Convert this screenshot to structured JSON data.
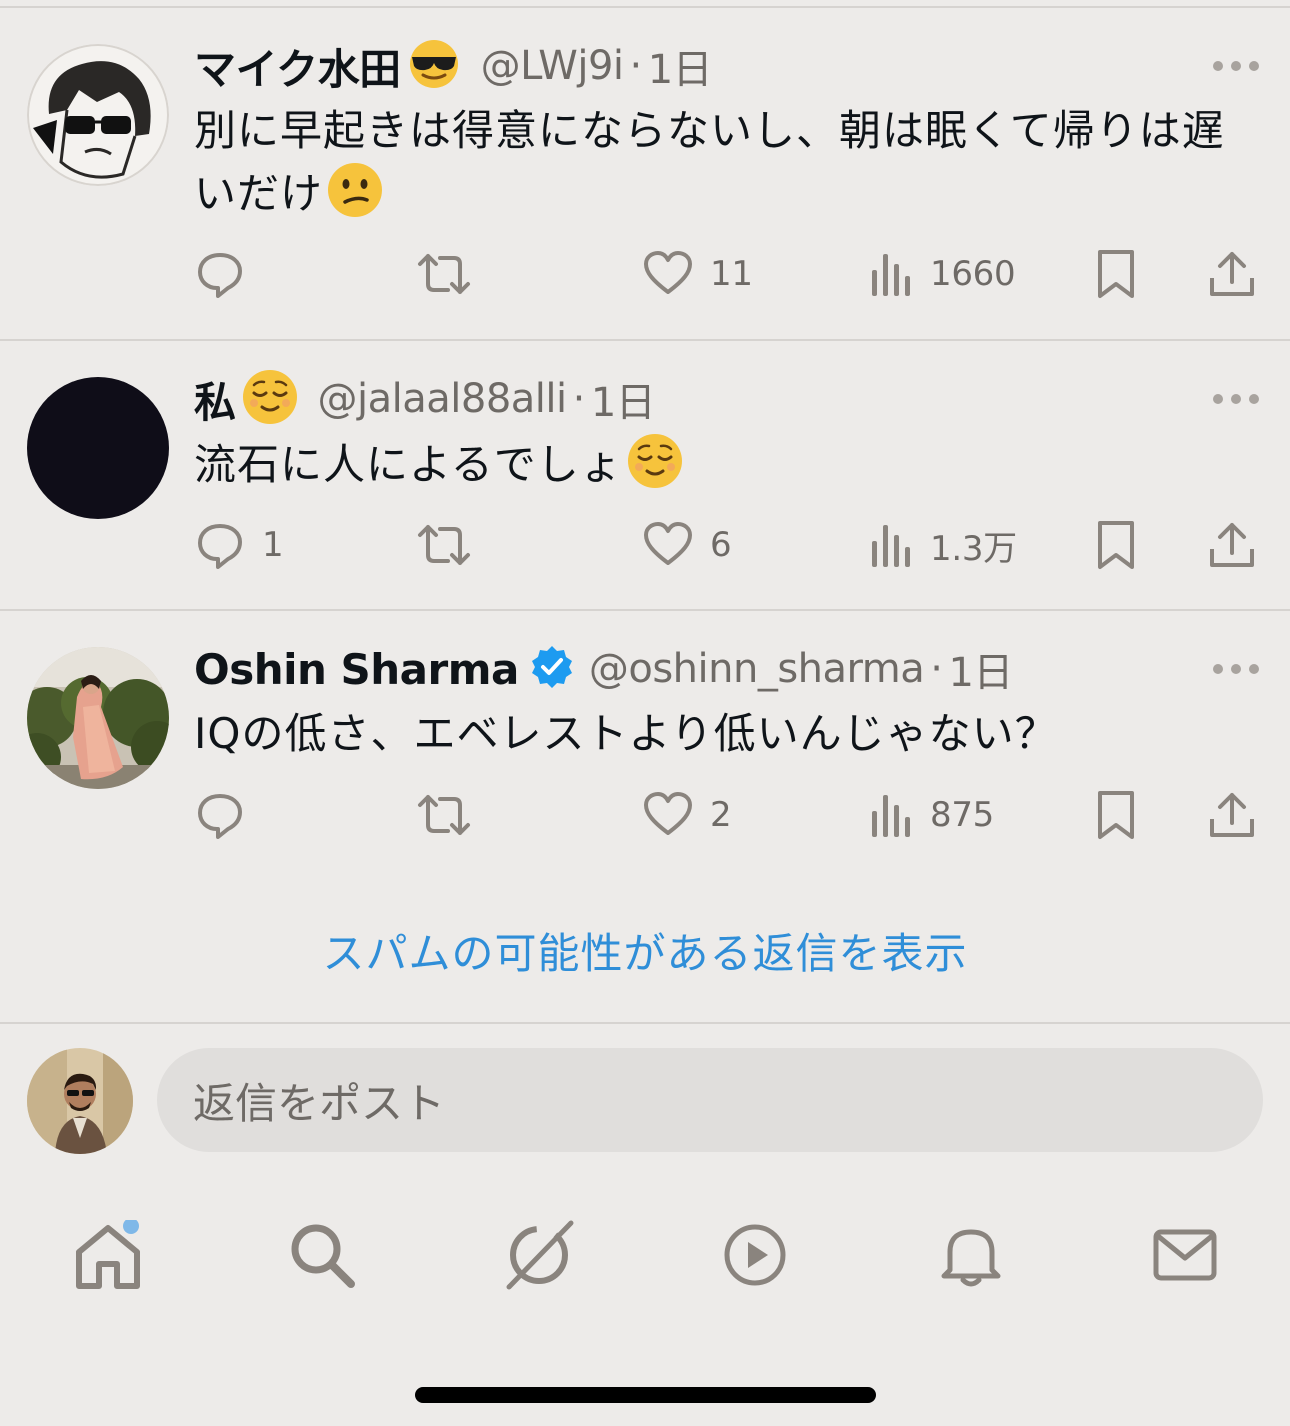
{
  "colors": {
    "background": "#edebe9",
    "text": "#0f1419",
    "secondary": "#6e6a66",
    "accent": "#2f8ed8",
    "verified": "#1d9bf0",
    "icon": "#8a847e"
  },
  "tweets": [
    {
      "name": "マイク水田",
      "name_emoji": "sunglasses-emoji",
      "handle": "@LWj9i",
      "dot": "·",
      "time": "1日",
      "text": "別に早起きは得意にならないし、朝は眠くて帰りは遅いだけ",
      "text_emoji": "confused-emoji",
      "verified": false,
      "counts": {
        "reply": "",
        "retweet": "",
        "like": "11",
        "views": "1660"
      }
    },
    {
      "name": "私",
      "name_emoji": "relieved-emoji",
      "handle": "@jalaal88alli",
      "dot": "·",
      "time": "1日",
      "text": "流石に人によるでしょ",
      "text_emoji": "relieved-emoji",
      "verified": false,
      "counts": {
        "reply": "1",
        "retweet": "",
        "like": "6",
        "views": "1.3万"
      }
    },
    {
      "name": "Oshin Sharma",
      "handle": "@oshinn_sharma",
      "dot": "·",
      "time": "1日",
      "text": "IQの低さ、エベレストより低いんじゃない？",
      "verified": true,
      "counts": {
        "reply": "",
        "retweet": "",
        "like": "2",
        "views": "875"
      }
    }
  ],
  "spam_link": "スパムの可能性がある返信を表示",
  "reply": {
    "placeholder": "返信をポスト"
  },
  "nav": [
    {
      "icon": "home-icon",
      "badge": true
    },
    {
      "icon": "search-icon"
    },
    {
      "icon": "grok-icon"
    },
    {
      "icon": "video-icon"
    },
    {
      "icon": "notifications-icon"
    },
    {
      "icon": "messages-icon"
    }
  ]
}
